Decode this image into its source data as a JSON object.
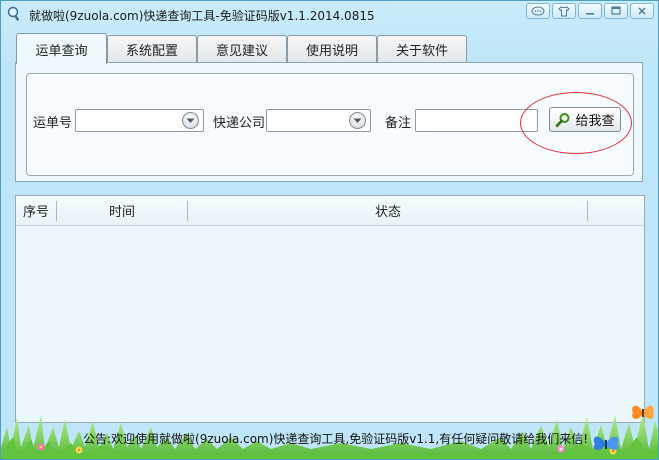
{
  "window": {
    "title": "就做啦(9zuola.com)快递查询工具-免验证码版v1.1.2014.0815"
  },
  "tabs": [
    {
      "label": "运单查询",
      "active": true
    },
    {
      "label": "系统配置",
      "active": false
    },
    {
      "label": "意见建议",
      "active": false
    },
    {
      "label": "使用说明",
      "active": false
    },
    {
      "label": "关于软件",
      "active": false
    }
  ],
  "query": {
    "waybill_label": "运单号",
    "waybill_value": "",
    "courier_label": "快递公司",
    "courier_value": "",
    "note_label": "备注",
    "note_value": "",
    "search_button_label": "给我查"
  },
  "table": {
    "columns": [
      "序号",
      "时间",
      "状态"
    ],
    "rows": []
  },
  "footer": {
    "notice": "公告:欢迎使用就做啦(9zuola.com)快递查询工具,免验证码版v1.1,有任何疑问敬请给我们来信!"
  },
  "colors": {
    "window_bg": "#bfe6f8",
    "panel_bg": "#eff8fd",
    "highlight_ellipse": "#e0323a",
    "grass": "#7dd35a"
  }
}
